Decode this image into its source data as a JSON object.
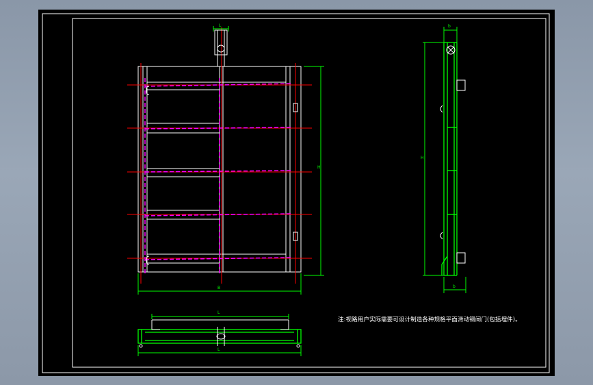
{
  "drawing": {
    "note": "注:视路用户实际需要可设计制造各种规格平面滑动钢闸门(包括埋件)。",
    "dim_labels": {
      "top_opening_width": "L",
      "front_height": "H",
      "front_width": "B",
      "side_height": "H",
      "side_top": "b",
      "side_bottom": "b",
      "plan_top": "L",
      "plan_bottom": "L"
    }
  },
  "colors": {
    "background": "#000000",
    "frame_line": "#ffffff",
    "dashed_centerline": "#ff00ff",
    "axis_line": "#ff0000",
    "side_view": "#00ff00",
    "dimension": "#00ff00",
    "window_bg": "#8a97a8"
  }
}
